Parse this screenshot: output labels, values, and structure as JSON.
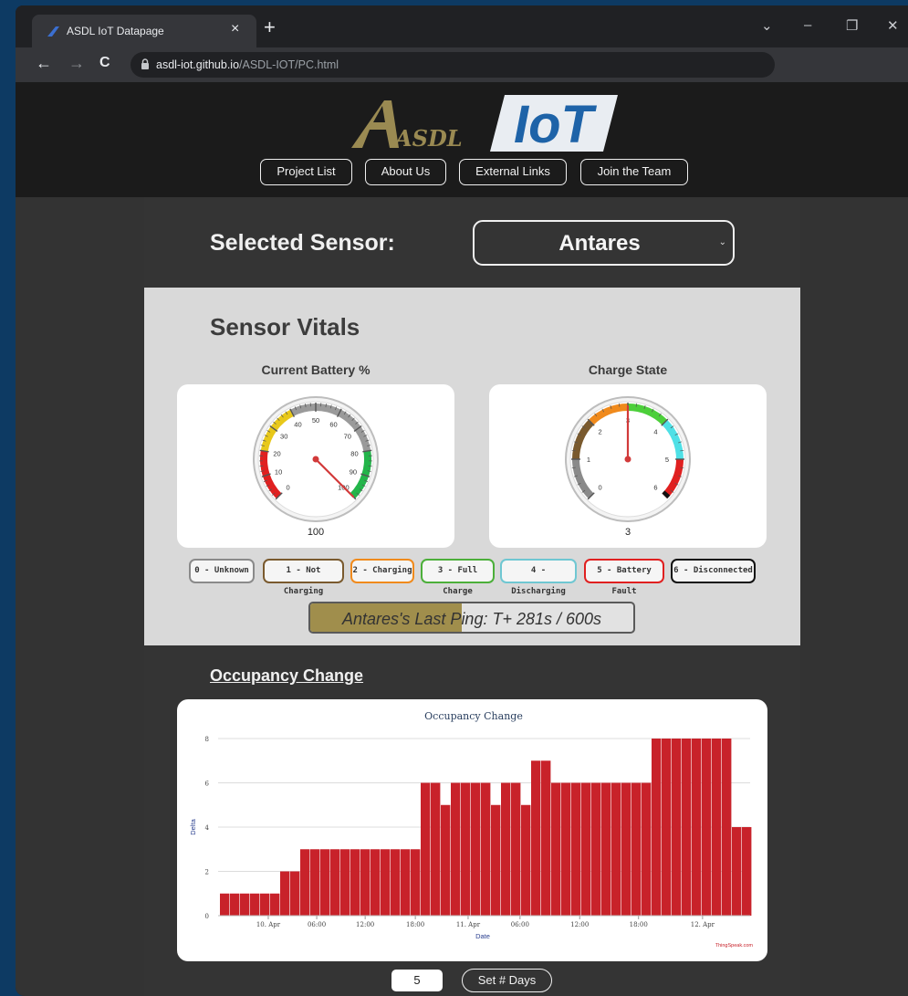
{
  "browser": {
    "tab_title": "ASDL IoT Datapage",
    "tab_close": "×",
    "new_tab": "+",
    "url_host": "asdl-iot.github.io",
    "url_path": "/ASDL-IOT/PC.html",
    "controls": {
      "tab_search": "⌄",
      "minimize": "–",
      "restore": "❐",
      "close": "✕"
    },
    "nav": {
      "back": "←",
      "forward": "→",
      "reload": "C"
    }
  },
  "header": {
    "logo_left": "ASDL",
    "logo_right": "IoT",
    "nav_buttons": [
      {
        "label": "Project List"
      },
      {
        "label": "About Us"
      },
      {
        "label": "External Links"
      },
      {
        "label": "Join the Team"
      }
    ]
  },
  "sensor_select": {
    "label": "Selected Sensor:",
    "value": "Antares",
    "caret": "⌄"
  },
  "vitals": {
    "title": "Sensor Vitals",
    "battery": {
      "label": "Current Battery %",
      "value": 100,
      "display": "100",
      "ticks": [
        "0",
        "10",
        "20",
        "30",
        "40",
        "50",
        "60",
        "70",
        "80",
        "90",
        "100"
      ]
    },
    "charge": {
      "label": "Charge State",
      "value": 3,
      "display": "3",
      "ticks": [
        "0",
        "1",
        "2",
        "3",
        "4",
        "5",
        "6"
      ]
    },
    "legend": [
      {
        "label": "0 - Unknown",
        "color": "#8a8a8a"
      },
      {
        "label": "1 - Not Charging",
        "color": "#7a5a2e"
      },
      {
        "label": "2 - Charging",
        "color": "#f08a1c"
      },
      {
        "label": "3 - Full Charge",
        "color": "#4caf3a"
      },
      {
        "label": "4 - Discharging",
        "color": "#6fc7d2"
      },
      {
        "label": "5 - Battery Fault",
        "color": "#e02020"
      },
      {
        "label": "6 - Disconnected",
        "color": "#111111"
      }
    ],
    "ping": {
      "text": "Antares's Last Ping: T+ 281s / 600s",
      "elapsed": 281,
      "max": 600
    }
  },
  "occupancy": {
    "section_title": "Occupancy Change",
    "credit": "ThingSpeak.com"
  },
  "chart_data": {
    "type": "bar",
    "title": "Occupancy Change",
    "xlabel": "Date",
    "ylabel": "Delta",
    "ylim": [
      0,
      8
    ],
    "yticks": [
      0,
      2,
      4,
      6,
      8
    ],
    "xticks": [
      "10. Apr",
      "06:00",
      "12:00",
      "18:00",
      "11. Apr",
      "06:00",
      "12:00",
      "18:00",
      "12. Apr"
    ],
    "grid": true,
    "bar_color": "#c8222a",
    "x": [
      "09 Apr 21:00",
      "09 Apr 22:00",
      "09 Apr 23:00",
      "10 Apr 00:00",
      "10 Apr 01:00",
      "10 Apr 02:00",
      "10 Apr 03:00",
      "10 Apr 04:00",
      "10 Apr 05:00",
      "10 Apr 06:00",
      "10 Apr 07:00",
      "10 Apr 08:00",
      "10 Apr 09:00",
      "10 Apr 10:00",
      "10 Apr 11:00",
      "10 Apr 12:00",
      "10 Apr 13:00",
      "10 Apr 14:00",
      "10 Apr 15:00",
      "10 Apr 16:00",
      "10 Apr 17:00",
      "10 Apr 18:00",
      "10 Apr 19:00",
      "10 Apr 20:00",
      "10 Apr 21:00",
      "10 Apr 22:00",
      "10 Apr 23:00",
      "11 Apr 00:00",
      "11 Apr 01:00",
      "11 Apr 02:00",
      "11 Apr 03:00",
      "11 Apr 04:00",
      "11 Apr 05:00",
      "11 Apr 06:00",
      "11 Apr 07:00",
      "11 Apr 08:00",
      "11 Apr 09:00",
      "11 Apr 10:00",
      "11 Apr 11:00",
      "11 Apr 12:00",
      "11 Apr 13:00",
      "11 Apr 14:00",
      "11 Apr 15:00",
      "11 Apr 16:00",
      "11 Apr 17:00",
      "11 Apr 18:00",
      "11 Apr 19:00",
      "11 Apr 20:00",
      "11 Apr 21:00",
      "11 Apr 22:00",
      "11 Apr 23:00",
      "12 Apr 00:00",
      "12 Apr 01:00"
    ],
    "values": [
      1,
      1,
      1,
      1,
      1,
      1,
      2,
      2,
      3,
      3,
      3,
      3,
      3,
      3,
      3,
      3,
      3,
      3,
      3,
      3,
      6,
      6,
      5,
      6,
      6,
      6,
      6,
      5,
      6,
      6,
      5,
      7,
      7,
      6,
      6,
      6,
      6,
      6,
      6,
      6,
      6,
      6,
      6,
      8,
      8,
      8,
      8,
      8,
      8,
      8,
      8,
      4,
      4
    ]
  },
  "days": {
    "value": "5",
    "button": "Set # Days"
  }
}
